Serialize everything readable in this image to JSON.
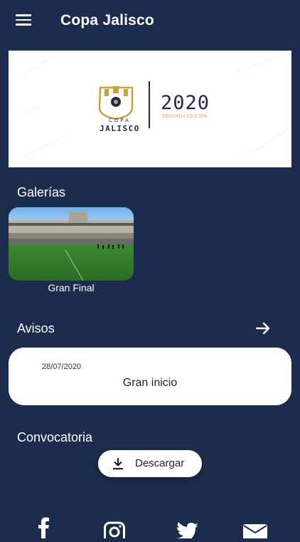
{
  "header": {
    "title": "Copa Jalisco",
    "menu_icon": "hamburger-menu-icon"
  },
  "banner": {
    "logo_top": "COPA",
    "logo_name": "JALISCO",
    "year": "2020",
    "edition": "SEGUNDA EDICIÓN",
    "colors": {
      "gold": "#caa23a",
      "navy": "#24245e"
    }
  },
  "galleries": {
    "title": "Galerías",
    "items": [
      {
        "label": "Gran Final"
      }
    ]
  },
  "notices": {
    "title": "Avisos",
    "arrow_icon": "arrow-right-icon",
    "items": [
      {
        "date": "28/07/2020",
        "title": "Gran inicio"
      }
    ]
  },
  "call": {
    "title": "Convocatoria",
    "download_label": "Descargar",
    "download_icon": "download-icon"
  },
  "social_icons": [
    "facebook-icon",
    "instagram-icon",
    "twitter-icon",
    "email-icon"
  ],
  "theme": {
    "background": "#1c2c4c",
    "card": "#ffffff"
  }
}
